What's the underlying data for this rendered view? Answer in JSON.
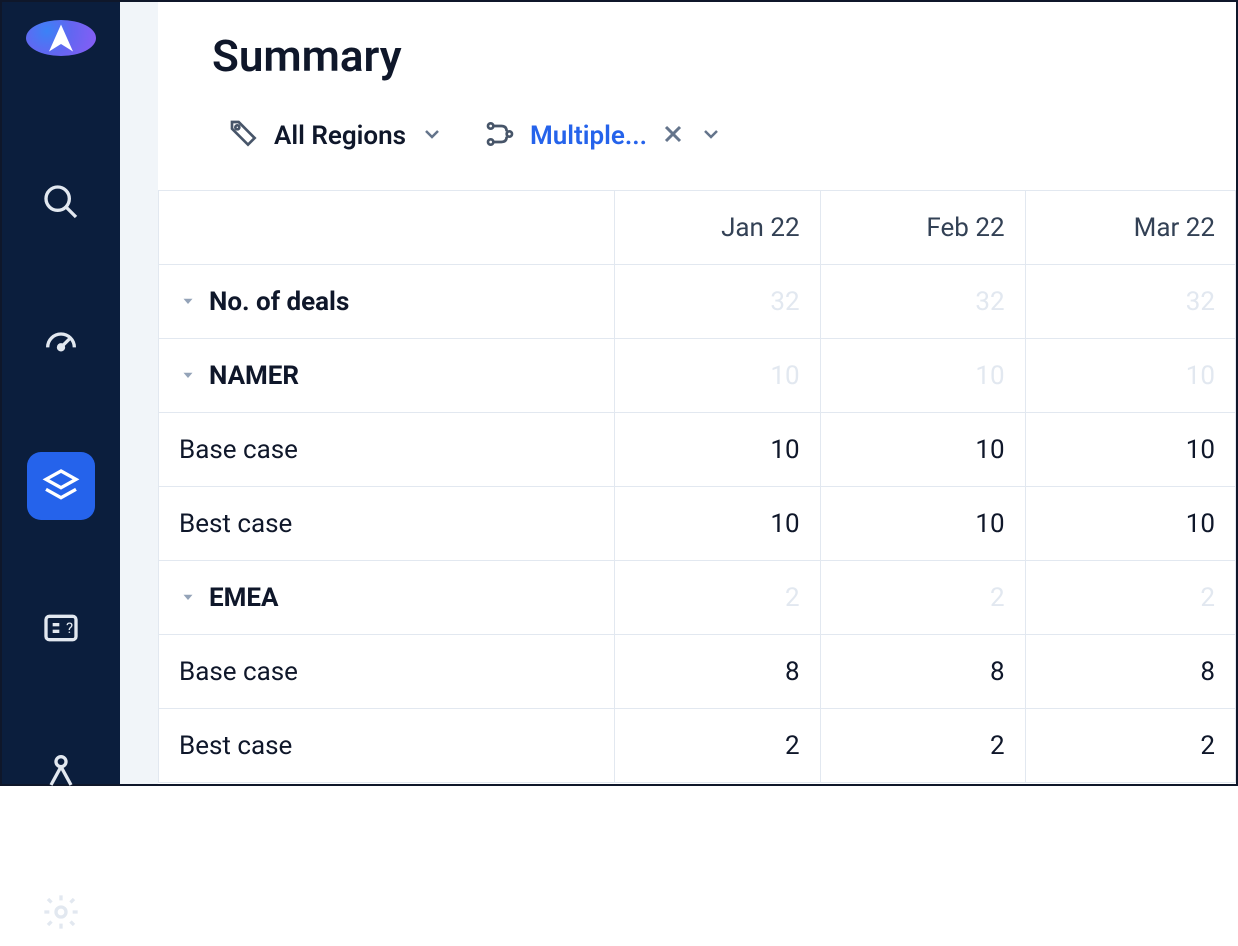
{
  "page": {
    "title": "Summary"
  },
  "filters": {
    "region": {
      "label": "All Regions"
    },
    "scenario": {
      "label": "Multiple..."
    }
  },
  "table": {
    "columns": [
      "Jan 22",
      "Feb 22",
      "Mar 22"
    ],
    "rows": [
      {
        "label": "No. of deals",
        "level": 0,
        "caret": true,
        "faded": true,
        "values": [
          "32",
          "32",
          "32"
        ]
      },
      {
        "label": "NAMER",
        "level": 1,
        "caret": true,
        "faded": true,
        "values": [
          "10",
          "10",
          "10"
        ]
      },
      {
        "label": "Base case",
        "level": 2,
        "caret": false,
        "faded": false,
        "values": [
          "10",
          "10",
          "10"
        ]
      },
      {
        "label": "Best case",
        "level": 2,
        "caret": false,
        "faded": false,
        "values": [
          "10",
          "10",
          "10"
        ]
      },
      {
        "label": "EMEA",
        "level": 1,
        "caret": true,
        "faded": true,
        "values": [
          "2",
          "2",
          "2"
        ]
      },
      {
        "label": "Base case",
        "level": 2,
        "caret": false,
        "faded": false,
        "values": [
          "8",
          "8",
          "8"
        ]
      },
      {
        "label": "Best case",
        "level": 2,
        "caret": false,
        "faded": false,
        "values": [
          "2",
          "2",
          "2"
        ]
      }
    ]
  }
}
